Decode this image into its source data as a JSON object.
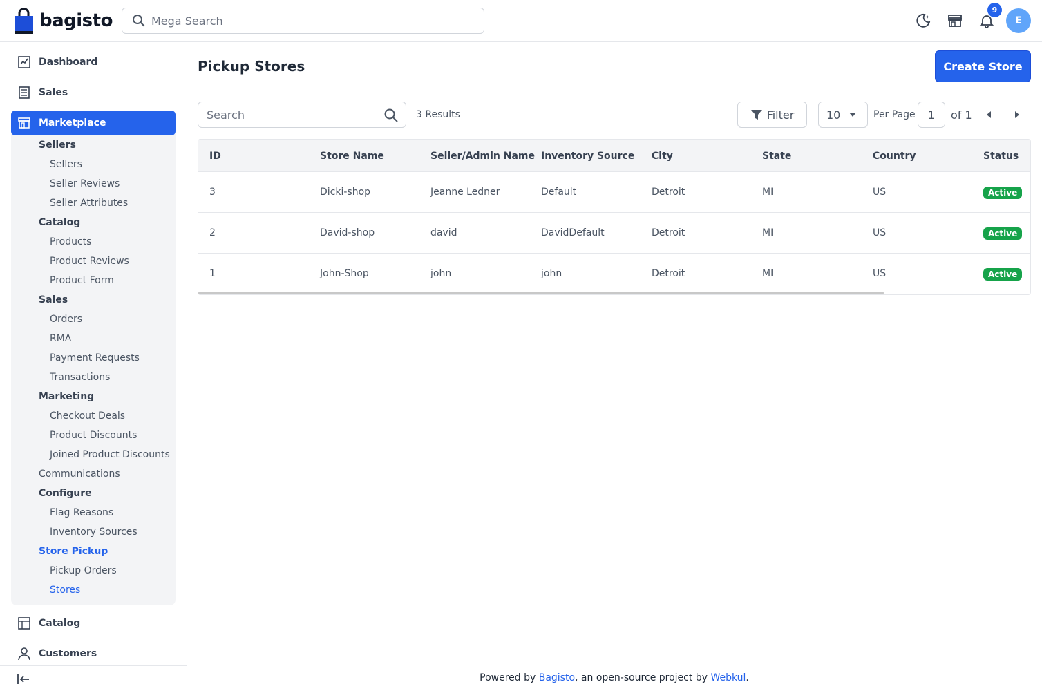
{
  "app": {
    "name": "bagisto"
  },
  "header": {
    "search_placeholder": "Mega Search",
    "notification_count": "9",
    "avatar_initial": "E",
    "icons": [
      "dark-mode-icon",
      "storefront-icon",
      "bell-icon"
    ]
  },
  "sidebar": {
    "top_items": [
      {
        "label": "Dashboard",
        "icon": "dashboard-icon"
      },
      {
        "label": "Sales",
        "icon": "sales-icon"
      }
    ],
    "marketplace": {
      "label": "Marketplace",
      "groups": {
        "sellers": {
          "label": "Sellers",
          "items": [
            "Sellers",
            "Seller Reviews",
            "Seller Attributes"
          ]
        },
        "catalog": {
          "label": "Catalog",
          "items": [
            "Products",
            "Product Reviews",
            "Product Form"
          ]
        },
        "sales": {
          "label": "Sales",
          "items": [
            "Orders",
            "RMA",
            "Payment Requests",
            "Transactions"
          ]
        },
        "marketing": {
          "label": "Marketing",
          "items": [
            "Checkout Deals",
            "Product Discounts",
            "Joined Product Discounts"
          ]
        },
        "communications": {
          "label": "Communications"
        },
        "configure": {
          "label": "Configure",
          "items": [
            "Flag Reasons",
            "Inventory Sources"
          ]
        },
        "store_pickup": {
          "label": "Store Pickup",
          "items": [
            "Pickup Orders",
            "Stores"
          ]
        }
      }
    },
    "bottom_items": [
      {
        "label": "Catalog",
        "icon": "catalog-icon"
      },
      {
        "label": "Customers",
        "icon": "customers-icon"
      }
    ]
  },
  "main": {
    "title": "Pickup Stores",
    "create_button": "Create Store",
    "search_placeholder": "Search",
    "results": "3 Results",
    "filter_label": "Filter",
    "per_page_value": "10",
    "per_page_label": "Per Page",
    "current_page": "1",
    "of_pages": "of 1",
    "columns": [
      "ID",
      "Store Name",
      "Seller/Admin Name",
      "Inventory Source",
      "City",
      "State",
      "Country",
      "Status"
    ],
    "rows": [
      {
        "id": "3",
        "store": "Dicki-shop",
        "seller": "Jeanne Ledner",
        "source": "Default",
        "city": "Detroit",
        "state": "MI",
        "country": "US",
        "status": "Active"
      },
      {
        "id": "2",
        "store": "David-shop",
        "seller": "david",
        "source": "DavidDefault",
        "city": "Detroit",
        "state": "MI",
        "country": "US",
        "status": "Active"
      },
      {
        "id": "1",
        "store": "John-Shop",
        "seller": "john",
        "source": "john",
        "city": "Detroit",
        "state": "MI",
        "country": "US",
        "status": "Active"
      }
    ]
  },
  "footer": {
    "prefix": "Powered by ",
    "link1": "Bagisto",
    "middle": ", an open-source project by ",
    "link2": "Webkul",
    "suffix": "."
  },
  "colors": {
    "accent": "#2563eb",
    "status_active": "#16a34a"
  }
}
